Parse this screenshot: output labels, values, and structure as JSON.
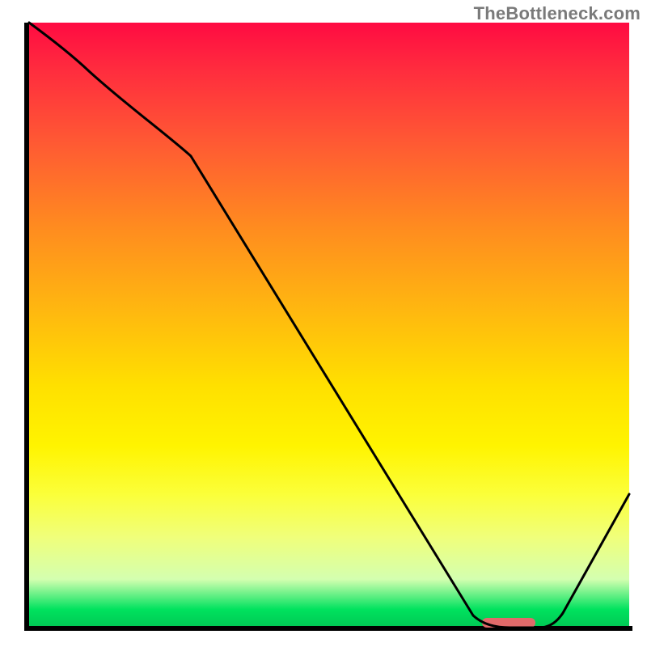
{
  "watermark": "TheBottleneck.com",
  "chart_data": {
    "type": "line",
    "title": "",
    "xlabel": "",
    "ylabel": "",
    "xlim": [
      0,
      100
    ],
    "ylim": [
      0,
      100
    ],
    "grid": false,
    "legend": false,
    "series": [
      {
        "name": "bottleneck-curve",
        "x": [
          0,
          10,
          27,
          74,
          80,
          85,
          100
        ],
        "y": [
          100,
          92,
          78,
          2,
          0,
          0,
          22
        ]
      }
    ],
    "marker": {
      "name": "optimal-range",
      "x_range": [
        76,
        85
      ],
      "y": 0,
      "color": "#e06a6a"
    },
    "background_gradient": {
      "top": "#ff0b42",
      "mid": "#ffe000",
      "bottom": "#00c854"
    }
  }
}
